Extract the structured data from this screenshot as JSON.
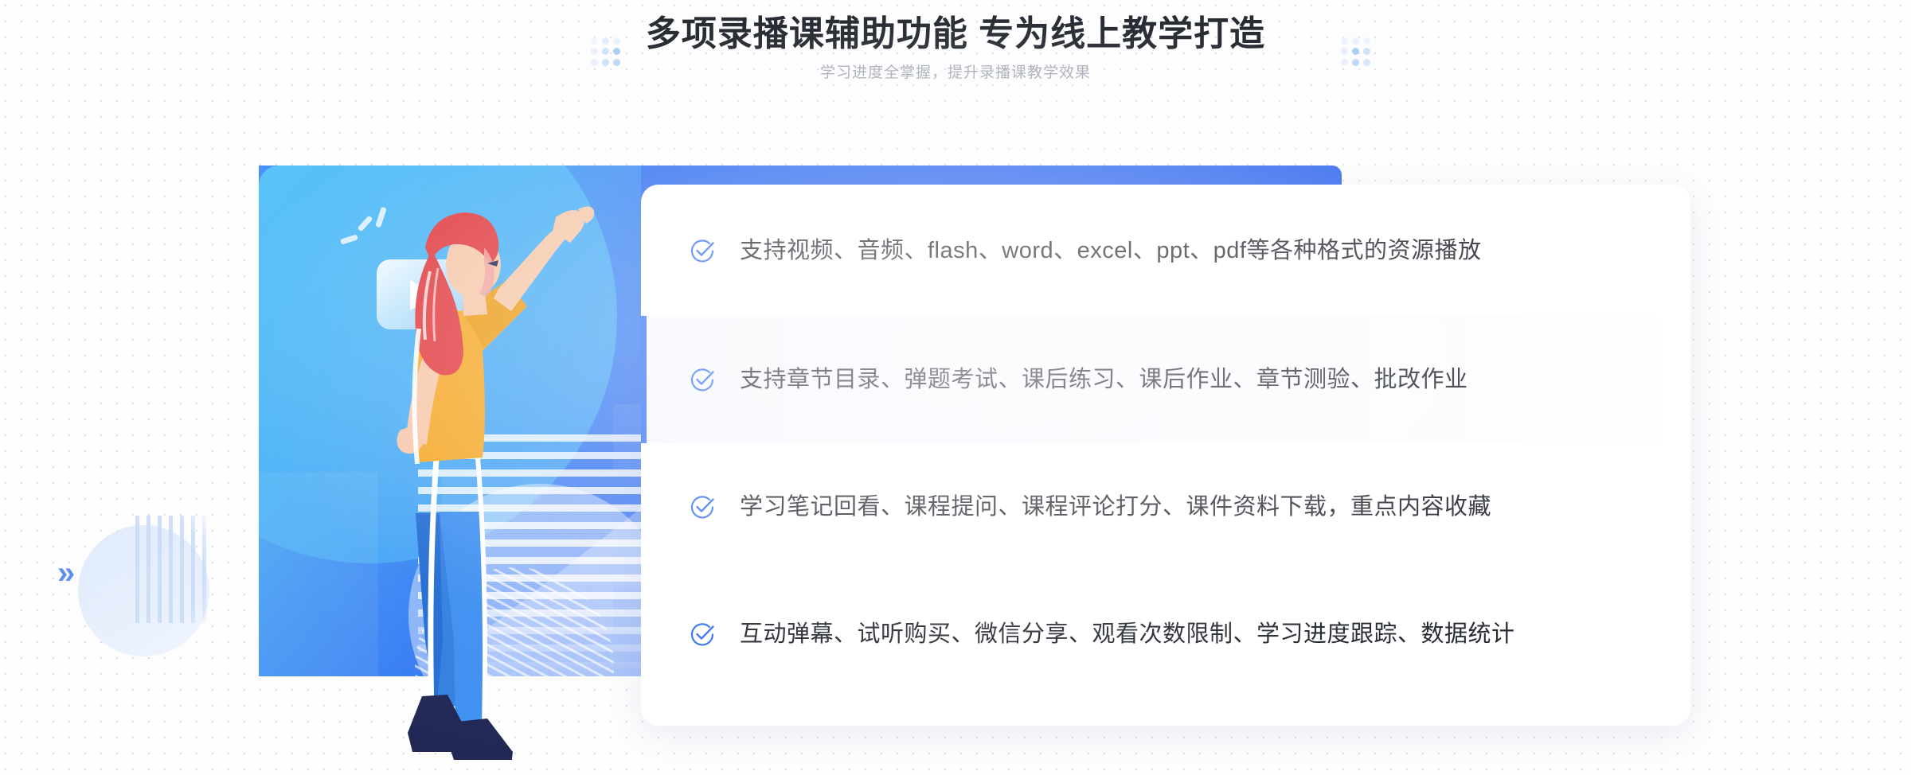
{
  "header": {
    "title": "多项录播课辅助功能 专为线上教学打造",
    "subtitle": "学习进度全掌握，提升录播课教学效果"
  },
  "colors": {
    "accent_blue": "#2f6ff2",
    "light_blue": "#4fc3f7",
    "title_text": "#1d2129",
    "subtitle_text": "#a3a9b5",
    "card_bg": "#ffffff",
    "highlight_row_bg": "#f5f7fc",
    "page_bg": "#fdfdfe",
    "shirt_yellow": "#f5a623",
    "hair_red": "#e0393e",
    "pants_blue": "#2f7de0",
    "shoe_navy": "#1c2250",
    "skin": "#f6c6a8"
  },
  "illustration": {
    "play_icon_name": "play-button-bubble",
    "character": "woman-pointing-up",
    "chevron_right": "»",
    "chevron_left": "«"
  },
  "features": [
    {
      "icon": "check-circle-icon",
      "text": "支持视频、音频、flash、word、excel、ppt、pdf等各种格式的资源播放",
      "highlighted": false
    },
    {
      "icon": "check-circle-icon",
      "text": "支持章节目录、弹题考试、课后练习、课后作业、章节测验、批改作业",
      "highlighted": true
    },
    {
      "icon": "check-circle-icon",
      "text": "学习笔记回看、课程提问、课程评论打分、课件资料下载，重点内容收藏",
      "highlighted": false
    },
    {
      "icon": "check-circle-icon",
      "text": "互动弹幕、试听购买、微信分享、观看次数限制、学习进度跟踪、数据统计",
      "highlighted": false
    }
  ]
}
